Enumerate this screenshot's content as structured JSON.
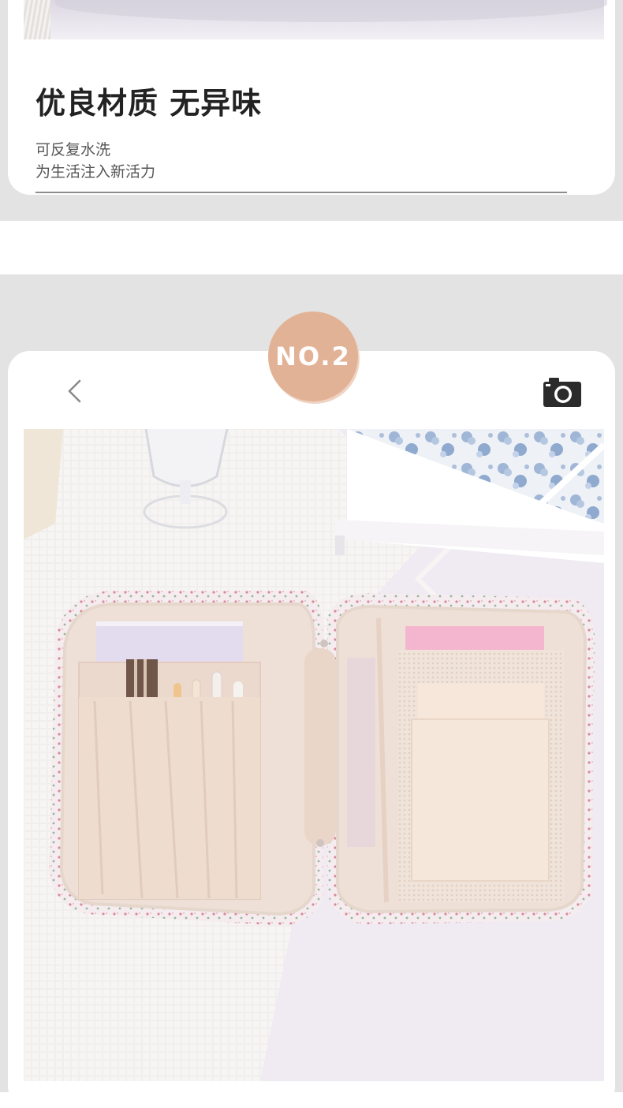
{
  "feature": {
    "headline": "优良材质 无异味",
    "sub_lines": [
      "可反复水洗",
      "为生活注入新活力"
    ]
  },
  "badge": {
    "label": "NO.2"
  },
  "toolbar": {
    "back_icon": "chevron-left-icon",
    "camera_icon": "camera-icon"
  },
  "colors": {
    "band": "#e3e3e3",
    "badge": "#e2b296",
    "text": "#222222"
  }
}
